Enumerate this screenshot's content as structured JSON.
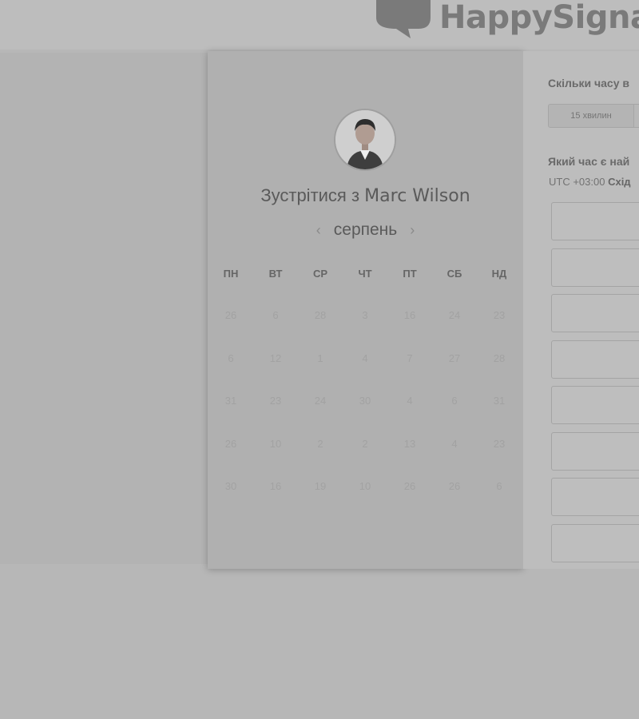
{
  "header": {
    "brand": "HappySigna",
    "logo_icon": "speech-bubble-heart-icon"
  },
  "scheduler": {
    "title_prefix": "Зустрітися з",
    "host_name": "Marc Wilson",
    "month": "серпень",
    "prev_icon": "chevron-left-icon",
    "next_icon": "chevron-right-icon",
    "weekdays": [
      "ПН",
      "ВТ",
      "СР",
      "ЧТ",
      "ПТ",
      "СБ",
      "НД"
    ],
    "weeks": [
      [
        "26",
        "6",
        "28",
        "3",
        "16",
        "24",
        "23"
      ],
      [
        "6",
        "12",
        "1",
        "4",
        "7",
        "27",
        "28"
      ],
      [
        "31",
        "23",
        "24",
        "30",
        "4",
        "6",
        "31"
      ],
      [
        "26",
        "10",
        "2",
        "2",
        "13",
        "4",
        "23"
      ],
      [
        "30",
        "16",
        "19",
        "10",
        "26",
        "26",
        "6"
      ]
    ]
  },
  "booking": {
    "duration_question": "Скільки часу в",
    "duration_option": "15 хвилин",
    "time_question": "Який час є най",
    "timezone_offset": "UTC +03:00",
    "timezone_name": "Схід",
    "slot_count": 8
  }
}
